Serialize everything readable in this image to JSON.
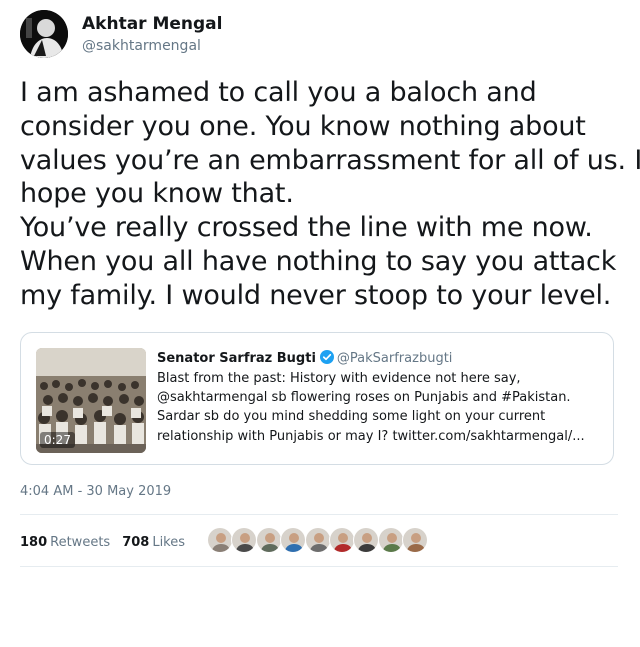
{
  "author": {
    "name": "Akhtar Mengal",
    "handle": "@sakhtarmengal",
    "avatar_icon": "profile-photo-icon"
  },
  "tweet": {
    "lines": [
      "I am ashamed to call you a baloch and",
      "consider you one. You know nothing about",
      "values you’re an embarrassment for all of us. I",
      "hope you know that.",
      "You’ve really crossed the line with me now.",
      "When you all have nothing to say you attack",
      "my family. I would never stoop to your level."
    ]
  },
  "quote": {
    "name": "Senator Sarfraz Bugti",
    "handle": "@PakSarfrazbugti",
    "verified_icon": "verified-badge-icon",
    "media_duration": "0:27",
    "lines": [
      "Blast from the past: History with evidence not here say,",
      "@sakhtarmengal sb flowering roses on Punjabis and #Pakistan.",
      "Sardar sb do you mind shedding some light on your current",
      "relationship with Punjabis or may I? twitter.com/sakhtarmengal/..."
    ]
  },
  "timestamp": "4:04 AM - 30 May 2019",
  "stats": {
    "retweets_count": "180",
    "retweets_label": "Retweets",
    "likes_count": "708",
    "likes_label": "Likes"
  },
  "likers": [
    {
      "icon": "liker-avatar-icon",
      "color": "#8a7f76"
    },
    {
      "icon": "liker-avatar-icon",
      "color": "#4a4a4a"
    },
    {
      "icon": "liker-avatar-icon",
      "color": "#5f6b5c"
    },
    {
      "icon": "liker-avatar-icon",
      "color": "#2f6fb0"
    },
    {
      "icon": "liker-avatar-icon",
      "color": "#6d6d6d"
    },
    {
      "icon": "liker-avatar-icon",
      "color": "#b22a2a"
    },
    {
      "icon": "liker-avatar-icon",
      "color": "#3b3b3b"
    },
    {
      "icon": "liker-avatar-icon",
      "color": "#5b7a4a"
    },
    {
      "icon": "liker-avatar-icon",
      "color": "#9a6a48"
    }
  ],
  "colors": {
    "text": "#14171a",
    "muted": "#657786",
    "border": "#e6ecf0",
    "verified": "#1da1f2"
  }
}
